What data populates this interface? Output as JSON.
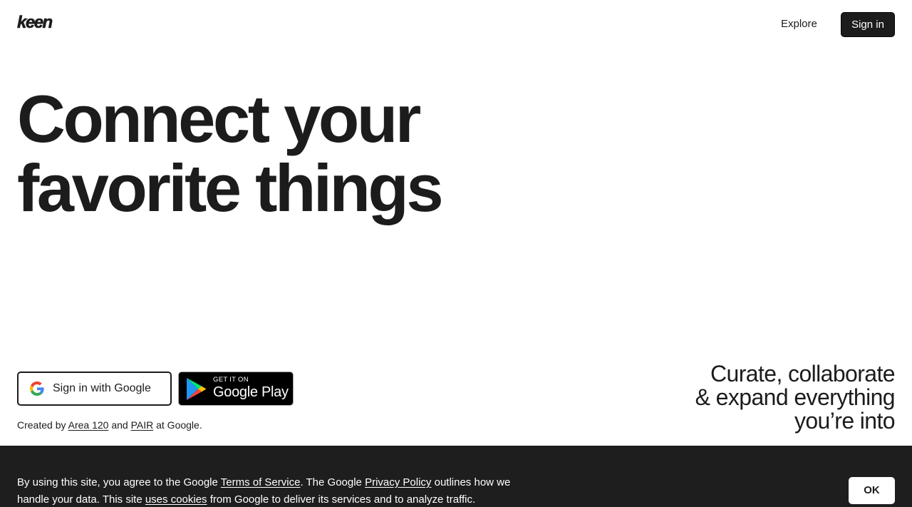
{
  "header": {
    "logo": "keen",
    "explore_label": "Explore",
    "signin_label": "Sign in"
  },
  "hero": {
    "line1": "Connect your",
    "line2": "favorite things"
  },
  "actions": {
    "google_signin_label": "Sign in with Google",
    "play_small": "GET IT ON",
    "play_big": "Google Play"
  },
  "credits": {
    "prefix": "Created by",
    "link1": "Area 120",
    "middle": "and",
    "link2": "PAIR",
    "suffix": "at Google."
  },
  "tagline": {
    "line1": "Curate, collaborate",
    "line2": "& expand everything",
    "line3": "you’re into"
  },
  "cookie": {
    "part1": "By using this site, you agree to the Google",
    "tos_link": "Terms of Service",
    "part2": ". The Google",
    "privacy_link": "Privacy Policy",
    "part3": "outlines how we handle your data. This site",
    "cookies_link": "uses cookies",
    "part4": "from Google to deliver its services and to analyze traffic.",
    "ok_label": "OK"
  },
  "colors": {
    "text": "#1c1c1c",
    "cookie_bg": "#1e1e1e",
    "button_dark": "#1c1c1c"
  }
}
